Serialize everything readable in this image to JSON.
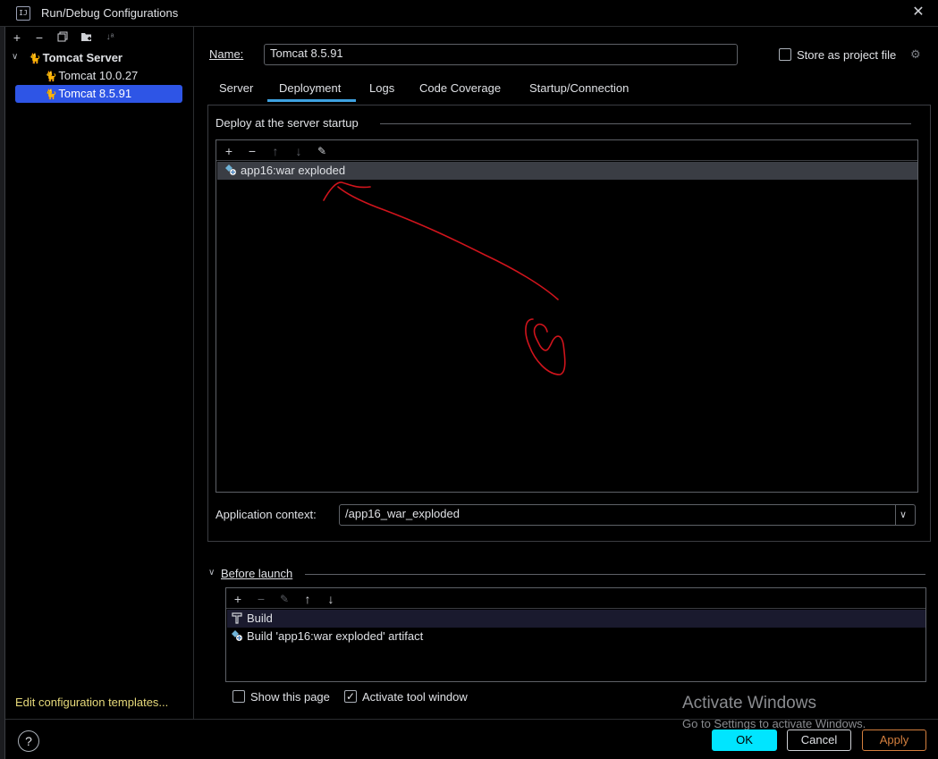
{
  "window": {
    "title": "Run/Debug Configurations",
    "app_icon_text": "IJ"
  },
  "sidebar": {
    "group_label": "Tomcat Server",
    "items": [
      {
        "label": "Tomcat 10.0.27",
        "selected": false
      },
      {
        "label": "Tomcat 8.5.91",
        "selected": true
      }
    ],
    "edit_templates_label": "Edit configuration templates..."
  },
  "form": {
    "name_label": "Name:",
    "name_value": "Tomcat 8.5.91",
    "store_label": "Store as project file",
    "store_checked": false
  },
  "tabs": [
    {
      "label": "Server"
    },
    {
      "label": "Deployment",
      "active": true
    },
    {
      "label": "Logs"
    },
    {
      "label": "Code Coverage"
    },
    {
      "label": "Startup/Connection"
    }
  ],
  "deploy": {
    "section_label": "Deploy at the server startup",
    "items": [
      {
        "label": "app16:war exploded",
        "selected": true
      }
    ],
    "context_label": "Application context:",
    "context_value": "/app16_war_exploded"
  },
  "before_launch": {
    "section_label": "Before launch",
    "items": [
      {
        "label": "Build",
        "icon": "hammer-icon",
        "selected": true
      },
      {
        "label": "Build 'app16:war exploded' artifact",
        "icon": "artifact-icon",
        "selected": false
      }
    ],
    "show_page_label": "Show this page",
    "show_page_checked": false,
    "activate_label": "Activate tool window",
    "activate_checked": true
  },
  "watermark": {
    "line1": "Activate Windows",
    "line2": "Go to Settings to activate Windows."
  },
  "buttons": {
    "ok": "OK",
    "cancel": "Cancel",
    "apply": "Apply"
  },
  "colors": {
    "accent": "#2e55e6",
    "ok_button": "#00e5ff",
    "apply_button": "#d47f3e",
    "tab_underline": "#3ea2e0",
    "annotation_ink": "#d0141c"
  }
}
